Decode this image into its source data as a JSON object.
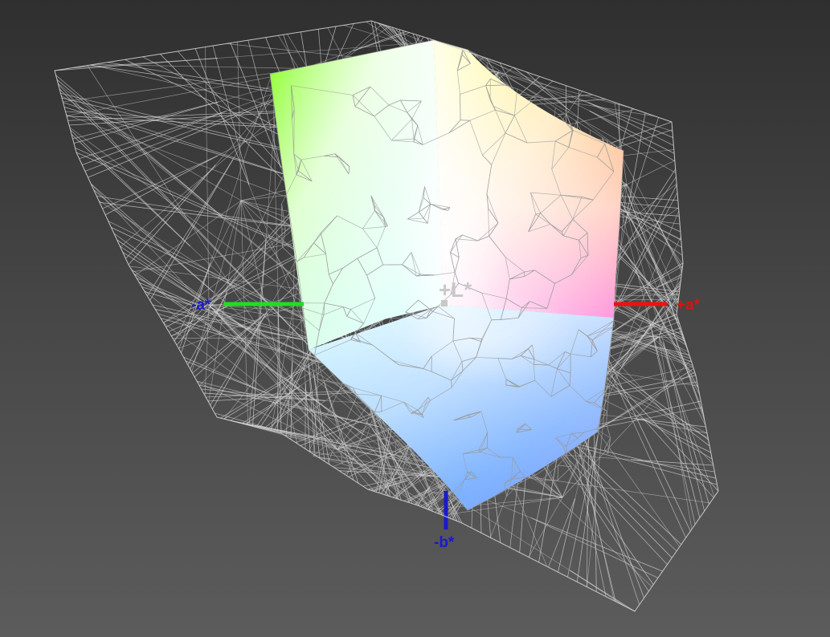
{
  "axes": {
    "plus_L": {
      "label": "+L*",
      "color": "#c8c8c8"
    },
    "minus_a": {
      "label": "-a*",
      "color": "#1a1acc",
      "line_color": "#22dd22"
    },
    "plus_a": {
      "label": "+a*",
      "color": "#dd1111",
      "line_color": "#ee1111"
    },
    "minus_b": {
      "label": "-b*",
      "color": "#1a1acc",
      "line_color": "#1a1acc"
    }
  },
  "colors": {
    "background_top": "#2f2f2f",
    "background_bottom": "#5c5c5c",
    "wireframe": "#d4d4d4",
    "solid_mesh": "#9a9a9a"
  }
}
